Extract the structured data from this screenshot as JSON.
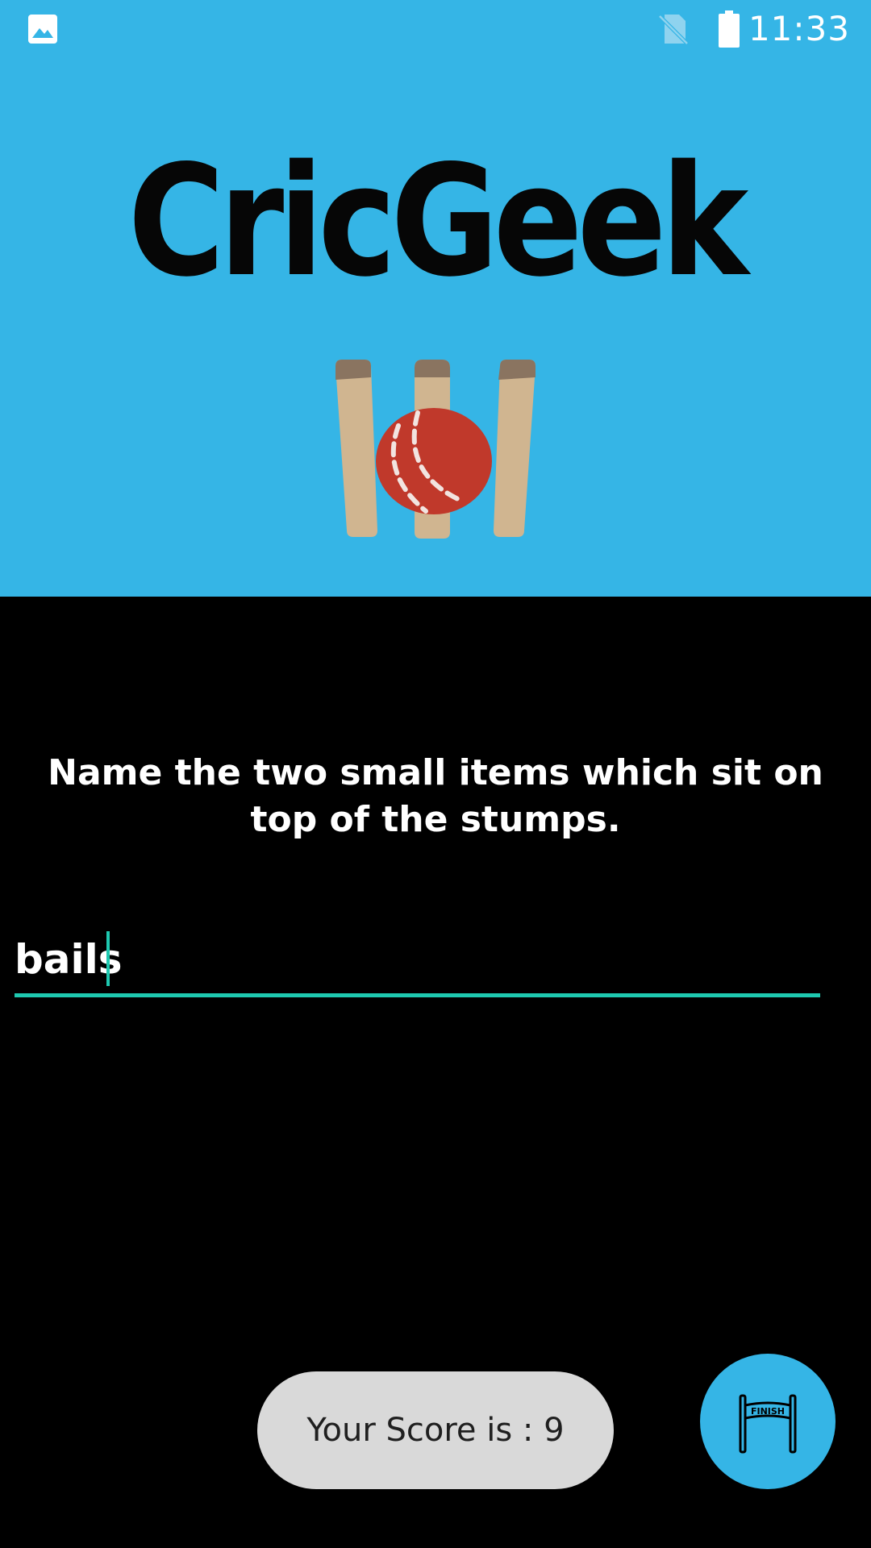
{
  "status_bar": {
    "time": "11:33",
    "icons": [
      "image-icon",
      "no-sim-icon",
      "battery-icon"
    ]
  },
  "app": {
    "title": "CricGeek",
    "logo_icon": "cricket-wicket-ball-icon"
  },
  "quiz": {
    "question": "Name the two small items which sit on top of the stumps.",
    "answer_value": "bails",
    "answer_placeholder": ""
  },
  "score": {
    "text": "Your Score is : 9"
  },
  "finish_button": {
    "icon": "finish-line-icon",
    "label": "FINISH"
  },
  "colors": {
    "header_bg": "#35b5e6",
    "page_bg": "#000000",
    "accent": "#1ec8b0",
    "toast_bg": "#d9d9d9",
    "ball": "#c0392b",
    "stump": "#d0b590",
    "stump_top": "#8a7460"
  }
}
